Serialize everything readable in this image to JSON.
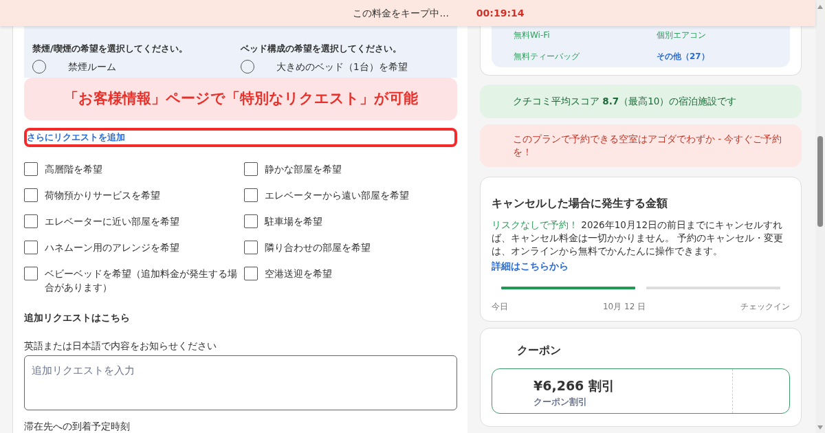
{
  "banner": {
    "text": "この料金をキープ中...",
    "timer": "00:19:14"
  },
  "preferences": {
    "groups": [
      {
        "title": "禁煙/喫煙の希望を選択してください。",
        "options": [
          {
            "label": "禁煙ルーム",
            "selected": false
          }
        ]
      },
      {
        "title": "ベッド構成の希望を選択してください。",
        "options": [
          {
            "label": "大きめのベッド（1台）を希望",
            "selected": false
          }
        ]
      }
    ]
  },
  "annotation": {
    "text": "「お客様情報」ページで「特別なリクエスト」が可能"
  },
  "add_request_link": "さらにリクエストを追加",
  "requests": [
    {
      "label": "高層階を希望",
      "checked": false
    },
    {
      "label": "静かな部屋を希望",
      "checked": false
    },
    {
      "label": "荷物預かりサービスを希望",
      "checked": false
    },
    {
      "label": "エレベーターから遠い部屋を希望",
      "checked": false
    },
    {
      "label": "エレベーターに近い部屋を希望",
      "checked": false
    },
    {
      "label": "駐車場を希望",
      "checked": false
    },
    {
      "label": "ハネムーン用のアレンジを希望",
      "checked": false
    },
    {
      "label": "隣り合わせの部屋を希望",
      "checked": false
    },
    {
      "label": "ベビーベッドを希望（追加料金が発生する場合があります）",
      "checked": false
    },
    {
      "label": "空港送迎を希望",
      "checked": false
    }
  ],
  "extra_request": {
    "heading": "追加リクエストはこちら",
    "label": "英語または日本語で内容をお知らせください",
    "placeholder": "追加リクエストを入力"
  },
  "arrival_label": "滞在先への到着予定時刻",
  "amenities": [
    {
      "label": "無料Wi-Fi",
      "kind": "feature"
    },
    {
      "label": "個別エアコン",
      "kind": "feature"
    },
    {
      "label": "無料ティーバッグ",
      "kind": "feature"
    },
    {
      "label": "その他（27）",
      "kind": "more"
    }
  ],
  "review_notice": "クチコミ平均スコア **8.7**（最高10）の宿泊施設です",
  "availability_notice": "このプランで予約できる空室はアゴダでわずか - 今すぐご予約を！",
  "cancellation": {
    "title": "キャンセルした場合に発生する金額",
    "risk_free": "リスクなしで予約！",
    "text": "2026年10月12日の前日までにキャンセルすれば、キャンセル料金は一切かかりません。 予約のキャンセル・変更は、オンラインから無料でかんたんに操作できます。",
    "link": "詳細はこちらから",
    "segments": [
      {
        "done": true
      },
      {
        "done": false
      }
    ],
    "timeline_labels": [
      "今日",
      "10月 12 日",
      "チェックイン"
    ]
  },
  "coupon": {
    "title": "クーポン",
    "amount": "¥6,266 割引",
    "subtitle": "クーポン割引"
  }
}
